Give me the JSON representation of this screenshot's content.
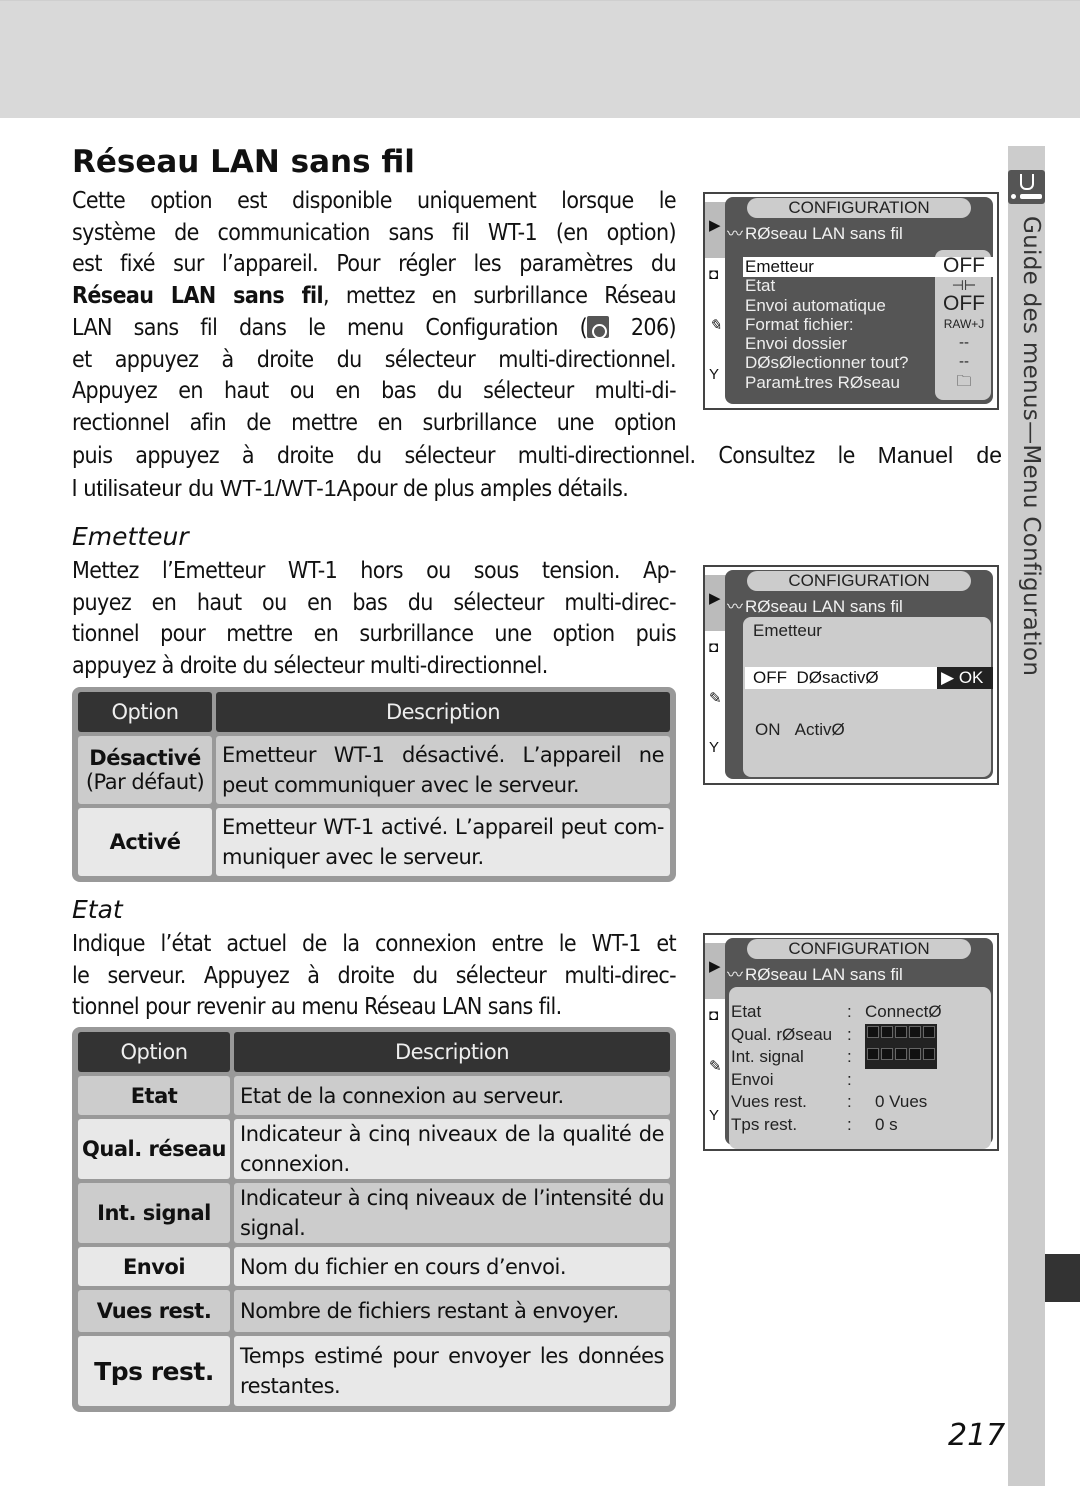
{
  "page": {
    "title": "Réseau LAN sans fil",
    "page_number": "217",
    "side_tab_label": "Guide des menus—Menu Configuration",
    "side_tab_icon": "wrench-icon"
  },
  "intro": {
    "lines": [
      "Cette option est disponible uniquement lorsque le",
      "système de communication sans fil WT-1 (en option)",
      "est fixé sur l’appareil. Pour régler les paramètres du",
      "Réseau LAN sans fil",
      ", mettez en surbrillance Réseau",
      "LAN sans fil dans le menu Configuration (",
      " 206)",
      "et appuyez à droite du sélecteur multi-directionnel.",
      "Appuyez en haut ou en bas du sélecteur multi-di-",
      "rectionnel afin de mettre en surbrillance une option",
      "puis appuyez à droite du sélecteur multi-directionnel. Consultez le ",
      "Manuel de",
      "l utilisateur du WT-1/WT-1A",
      "pour de plus amples détails."
    ]
  },
  "sections": {
    "emetteur": {
      "heading": "Emetteur",
      "lines": [
        "Mettez l’Emetteur WT-1 hors ou sous tension. Ap-",
        "puyez en haut ou en bas du sélecteur multi-direc-",
        "tionnel pour mettre en surbrillance une option puis",
        "appuyez à droite du sélecteur multi-directionnel."
      ],
      "table": {
        "headers": [
          "Option",
          "Description"
        ],
        "rows": [
          {
            "option": "Désactivé",
            "option_sub": "(Par défaut)",
            "description": "Emetteur WT-1 désactivé. L’appareil ne peut communiquer avec le serveur."
          },
          {
            "option": "Activé",
            "option_sub": "",
            "description": "Emetteur WT-1 activé. L’appareil peut com- muniquer avec le serveur."
          }
        ]
      }
    },
    "etat": {
      "heading": "Etat",
      "lines": [
        "Indique l’état actuel de la connexion entre le WT-1 et",
        "le serveur. Appuyez à droite du sélecteur multi-direc-",
        "tionnel pour revenir au menu Réseau LAN sans fil."
      ],
      "table": {
        "headers": [
          "Option",
          "Description"
        ],
        "rows": [
          {
            "option": "Etat",
            "description": "Etat de la connexion au serveur."
          },
          {
            "option": "Qual. réseau",
            "description": "Indicateur à cinq niveaux de la qualité de connexion."
          },
          {
            "option": "Int. signal",
            "description": "Indicateur à cinq niveaux de l’intensité du signal."
          },
          {
            "option": "Envoi",
            "description": "Nom du fichier en cours d’envoi."
          },
          {
            "option": "Vues rest.",
            "description": "Nombre de fichiers restant à envoyer."
          },
          {
            "option": "Tps rest.",
            "description": "Temps estimé pour envoyer les données restantes."
          }
        ]
      }
    }
  },
  "screens": {
    "menu": {
      "header": "CONFIGURATION",
      "subtitle": "RØseau LAN sans fil",
      "items": [
        {
          "label": "Emetteur",
          "value": "OFF",
          "selected": true
        },
        {
          "label": "Etat",
          "value": "⊣⊢"
        },
        {
          "label": "Envoi automatique",
          "value": "OFF"
        },
        {
          "label": "Format fichier:",
          "value": "RAW+J"
        },
        {
          "label": "Envoi dossier",
          "value": "--"
        },
        {
          "label": "DØsØlectionner tout?",
          "value": "--"
        },
        {
          "label": "ParamŁtres RØseau",
          "value": "folder-icon"
        }
      ]
    },
    "emetteur": {
      "header": "CONFIGURATION",
      "subtitle": "RØseau LAN sans fil",
      "title": "Emetteur",
      "options": [
        {
          "code": "OFF",
          "label": "DØsactivØ",
          "selected": true,
          "action": "OK"
        },
        {
          "code": "ON",
          "label": "ActivØ"
        }
      ]
    },
    "etat": {
      "header": "CONFIGURATION",
      "subtitle": "RØseau LAN sans fil",
      "rows": [
        {
          "label": "Etat",
          "value": "ConnectØ"
        },
        {
          "label": "Qual. rØseau",
          "value": "",
          "bars": 5
        },
        {
          "label": "Int. signal",
          "value": "",
          "bars": 5
        },
        {
          "label": "Envoi",
          "value": ""
        },
        {
          "label": "Vues rest.",
          "value": "0 Vues"
        },
        {
          "label": "Tps rest.",
          "value": "0 s"
        }
      ]
    }
  }
}
